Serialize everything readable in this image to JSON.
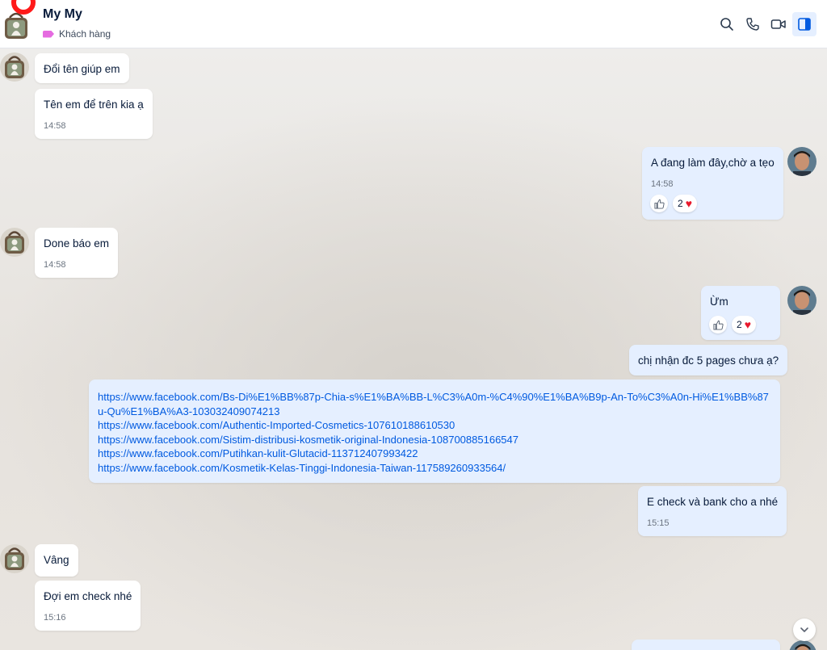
{
  "header": {
    "name": "My My",
    "tag": "Khách hàng",
    "icons": [
      "search-icon",
      "phone-icon",
      "video-icon",
      "sidebar-toggle-icon"
    ],
    "colors": {
      "tag": "#e56be0",
      "accent": "#005ae0",
      "notification_ring": "#ff1a1a"
    }
  },
  "messages": [
    {
      "sender": "contact",
      "text": "Đổi tên giúp em"
    },
    {
      "sender": "contact",
      "text": "Tên em để trên kia ạ",
      "time": "14:58"
    },
    {
      "sender": "me",
      "text": "A đang làm đây,chờ a tẹo",
      "time": "14:58",
      "reaction_count": "2"
    },
    {
      "sender": "contact",
      "text": "Done báo em",
      "time": "14:58"
    },
    {
      "sender": "me",
      "text": "Ừm",
      "reaction_count": "2"
    },
    {
      "sender": "me",
      "text": "chị nhận đc 5 pages chưa ạ?"
    },
    {
      "sender": "me",
      "links": [
        "https://www.facebook.com/Bs-Di%E1%BB%87p-Chia-s%E1%BA%BB-L%C3%A0m-%C4%90%E1%BA%B9p-An-To%C3%A0n-Hi%E1%BB%87u-Qu%E1%BA%A3-103032409074213",
        "https://www.facebook.com/Authentic-Imported-Cosmetics-107610188610530",
        "https://www.facebook.com/Sistim-distribusi-kosmetik-original-Indonesia-108700885166547",
        "https://www.facebook.com/Putihkan-kulit-Glutacid-113712407993422",
        "https://www.facebook.com/Kosmetik-Kelas-Tinggi-Indonesia-Taiwan-117589260933564/"
      ]
    },
    {
      "sender": "me",
      "text": "E check và bank cho a nhé",
      "time": "15:15"
    },
    {
      "sender": "contact",
      "text": "Vâng"
    },
    {
      "sender": "contact",
      "text": "Đợi em check nhé",
      "time": "15:16"
    }
  ]
}
